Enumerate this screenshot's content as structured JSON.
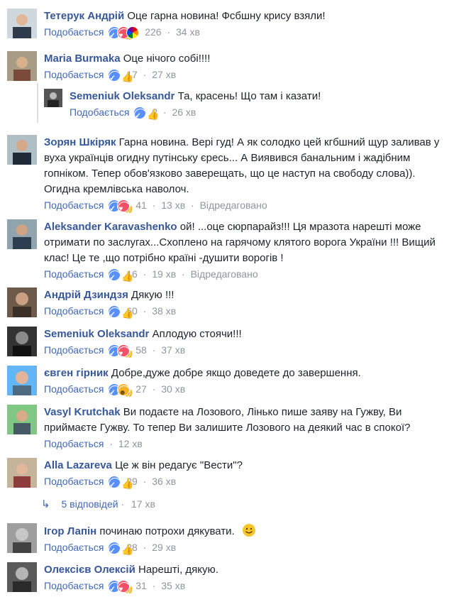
{
  "like_label": "Подобається",
  "edited_label": "Відредаговано",
  "colors": {
    "link": "#365899",
    "like": "#4267b2",
    "meta": "#90949c",
    "text": "#1d2129"
  },
  "comments": [
    {
      "author": "Тетерук Андрій",
      "text": "Оце гарна новина! Фсбшну крису взяли!",
      "reactions": [
        "like",
        "love",
        "pride"
      ],
      "count": "226",
      "time": "34 хв",
      "edited": ""
    },
    {
      "author": "Maria Burmaka",
      "text": "Оце нічого собі!!!!",
      "reactions": [
        "like"
      ],
      "count": "17",
      "time": "27 хв",
      "edited": ""
    },
    {
      "author": "Semeniuk Oleksandr",
      "text": "Та, красень! Що там і казати!",
      "reactions": [
        "like"
      ],
      "count": "2",
      "time": "26 хв",
      "edited": ""
    },
    {
      "author": "Зорян Шкіряк",
      "text": "Гарна новина. Вері гуд! А як солодко цей кгбшний щур заливав у вуха українців огидну путінську єресь... А Виявився банальним і жадібним гопніком. Тепер обов'язково заверещать, що це наступ на свободу слова)). Огидна кремлівська наволоч.",
      "reactions": [
        "like",
        "love"
      ],
      "count": "41",
      "time": "13 хв",
      "edited": "Відредаговано"
    },
    {
      "author": "Aleksander Karavashenko",
      "text": "ой! ...оце сюрпарайз!!! Ця мразота нарешті може отримати по заслугах...Схоплено на гарячому клятого ворога України !!! Вищий клас! Це те ,що потрібно країні -душити ворогів !",
      "reactions": [
        "like"
      ],
      "count": "16",
      "time": "19 хв",
      "edited": "Відредаговано"
    },
    {
      "author": "Андрій Дзиндзя",
      "text": "Дякую !!!",
      "reactions": [
        "like"
      ],
      "count": "60",
      "time": "38 хв",
      "edited": ""
    },
    {
      "author": "Semeniuk Oleksandr",
      "text": "Аплодую стоячи!!!",
      "reactions": [
        "like",
        "love"
      ],
      "count": "58",
      "time": "37 хв",
      "edited": ""
    },
    {
      "author": "євген гірник",
      "text": "Добре,дуже добре якщо доведете до завершення.",
      "reactions": [
        "like",
        "haha"
      ],
      "count": "27",
      "time": "30 хв",
      "edited": ""
    },
    {
      "author": "Vasyl Krutchak",
      "text": "Ви подаєте на Лозового, Лінько пише заяву на Гужву, Ви приймаєте Гужву. То тепер Ви залишите Лозового на деякий час в спокої?",
      "reactions": [],
      "count": "",
      "time": "12 хв",
      "edited": ""
    },
    {
      "author": "Alla Lazareva",
      "text": "Це ж він редагує \"Вести\"?",
      "reactions": [
        "like"
      ],
      "count": "29",
      "time": "36 хв",
      "edited": ""
    },
    {
      "author": "Ігор Лапін",
      "text": "починаю потрохи дякувати.",
      "reactions": [
        "like"
      ],
      "count": "28",
      "time": "29 хв",
      "edited": ""
    },
    {
      "author": "Олексієв Олексій",
      "text": "Нарешті, дякую.",
      "reactions": [
        "like",
        "love"
      ],
      "count": "31",
      "time": "35 хв",
      "edited": ""
    }
  ],
  "replies_link": {
    "label": "5 відповідей",
    "time": "17 хв"
  }
}
